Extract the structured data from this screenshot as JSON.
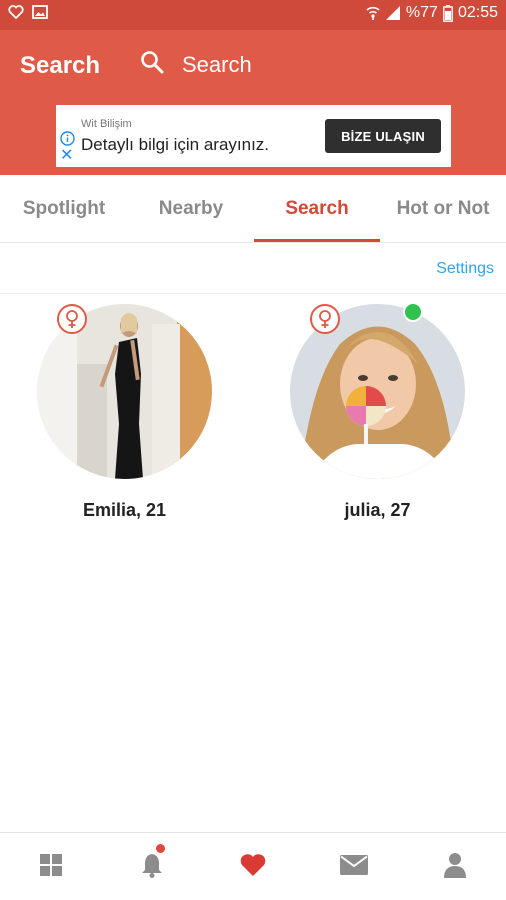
{
  "status_bar": {
    "battery_text": "%77",
    "time": "02:55"
  },
  "header": {
    "title": "Search",
    "search_placeholder": "Search"
  },
  "ad": {
    "sponsor": "Wit Bilişim",
    "text": "Detaylı bilgi için arayınız.",
    "button_label": "BİZE ULAŞIN"
  },
  "tabs": [
    {
      "label": "Spotlight"
    },
    {
      "label": "Nearby"
    },
    {
      "label": "Search",
      "active": true
    },
    {
      "label": "Hot or Not"
    }
  ],
  "settings_label": "Settings",
  "profiles": [
    {
      "name": "Emilia, 21",
      "gender_icon": "female-icon",
      "online": false
    },
    {
      "name": "julia, 27",
      "gender_icon": "female-icon",
      "online": true
    }
  ],
  "bottom_nav": [
    {
      "icon": "grid-icon"
    },
    {
      "icon": "bell-icon",
      "has_notification": true
    },
    {
      "icon": "heart-icon",
      "active": true
    },
    {
      "icon": "mail-icon"
    },
    {
      "icon": "person-icon"
    }
  ],
  "colors": {
    "status_bar": "#cf4a3a",
    "app_bar": "#e05a48",
    "accent": "#d24a36",
    "link": "#2fa4e7",
    "online": "#2fc24f",
    "nav_icon": "#8c8c8c"
  }
}
